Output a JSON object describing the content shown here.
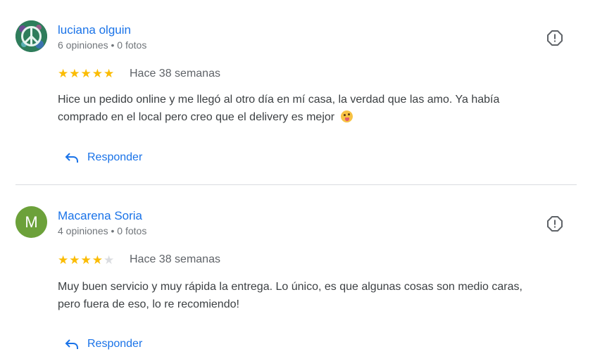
{
  "reviews": [
    {
      "name": "luciana olguin",
      "meta": "6 opiniones • 0 fotos",
      "rating": 5,
      "date": "Hace 38 semanas",
      "text_line1": "Hice un pedido online y me llegó al otro día en mí casa, la verdad que las amo. Ya había",
      "text_line2": "comprado en el local pero creo que el delivery es mejor",
      "reply_label": "Responder",
      "avatar_icon": "peace-symbol-icon"
    },
    {
      "name": "Macarena Soria",
      "meta": "4 opiniones • 0 fotos",
      "rating": 4,
      "date": "Hace 38 semanas",
      "text_line1": "Muy buen servicio y muy rápida la entrega. Lo único, es que algunas cosas son medio caras,",
      "text_line2": "pero fuera de eso, lo re recomiendo!",
      "reply_label": "Responder",
      "avatar_letter": "M"
    }
  ],
  "colors": {
    "link": "#1a73e8",
    "star": "#fbbc04",
    "avatar_m": "#6ca13a"
  }
}
